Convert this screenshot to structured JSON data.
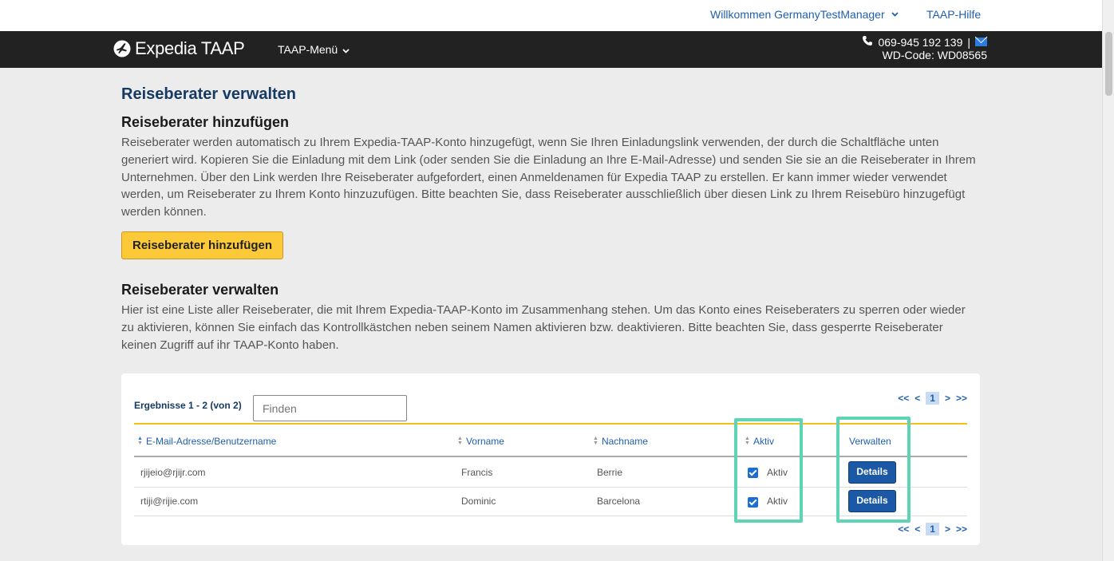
{
  "topbar": {
    "welcome": "Willkommen GermanyTestManager",
    "help": "TAAP-Hilfe"
  },
  "navbar": {
    "logo": "Expedia TAAP",
    "menu": "TAAP-Menü",
    "phone": "069-945 192 139",
    "separator": "|",
    "wd_code": "WD-Code: WD08565"
  },
  "page": {
    "title": "Reiseberater verwalten",
    "add_section": {
      "heading": "Reiseberater hinzufügen",
      "text": "Reiseberater werden automatisch zu Ihrem Expedia-TAAP-Konto hinzugefügt, wenn Sie Ihren Einladungslink verwenden, der durch die Schaltfläche unten generiert wird. Kopieren Sie die Einladung mit dem Link (oder senden Sie die Einladung an Ihre E-Mail-Adresse) und senden Sie sie an die Reiseberater in Ihrem Unternehmen. Über den Link werden Ihre Reiseberater aufgefordert, einen Anmeldenamen für Expedia TAAP zu erstellen. Er kann immer wieder verwendet werden, um Reiseberater zu Ihrem Konto hinzuzufügen. Bitte beachten Sie, dass Reiseberater ausschließlich über diesen Link zu Ihrem Reisebüro hinzugefügt werden können.",
      "button": "Reiseberater hinzufügen"
    },
    "manage_section": {
      "heading": "Reiseberater verwalten",
      "text": "Hier ist eine Liste aller Reiseberater, die mit Ihrem Expedia-TAAP-Konto im Zusammenhang stehen. Um das Konto eines Reiseberaters zu sperren oder wieder zu aktivieren, können Sie einfach das Kontrollkästchen neben seinem Namen aktivieren bzw. deaktivieren. Bitte beachten Sie, dass gesperrte Reiseberater keinen Zugriff auf ihr TAAP-Konto haben."
    }
  },
  "table": {
    "results": "Ergebnisse 1 - 2 (von 2)",
    "search_placeholder": "Finden",
    "pager": {
      "first": "<<",
      "prev": "<",
      "current": "1",
      "next": ">",
      "last": ">>"
    },
    "headers": {
      "email": "E-Mail-Adresse/Benutzername",
      "first": "Vorname",
      "last": "Nachname",
      "active": "Aktiv",
      "manage": "Verwalten"
    },
    "rows": [
      {
        "email": "rjijeio@rjijr.com",
        "first": "Francis",
        "last": "Berrie",
        "active_label": "Aktiv",
        "active": true,
        "button": "Details"
      },
      {
        "email": "rtiji@rijie.com",
        "first": "Dominic",
        "last": "Barcelona",
        "active_label": "Aktiv",
        "active": true,
        "button": "Details"
      }
    ]
  },
  "colors": {
    "brand_blue": "#163a62",
    "link_blue": "#1f5fad",
    "add_button": "#fcc938",
    "details_button": "#1b58a6",
    "highlight": "#5ed4b5",
    "table_accent": "#f2c315"
  },
  "icons": [
    "chevron-down-icon",
    "phone-icon",
    "mail-icon",
    "expedia-logo-icon",
    "sort-icon",
    "checkbox-icon"
  ]
}
